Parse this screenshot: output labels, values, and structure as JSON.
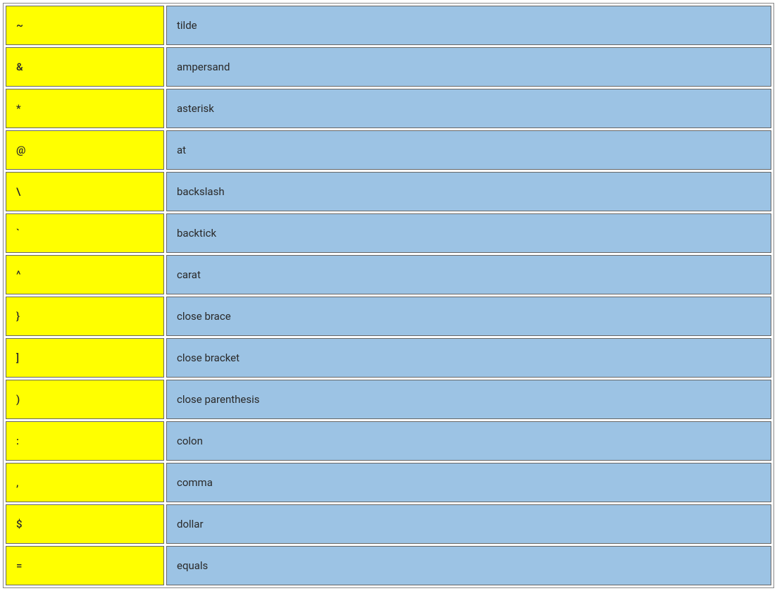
{
  "rows": [
    {
      "symbol": "~",
      "name": "tilde"
    },
    {
      "symbol": "&",
      "name": "ampersand"
    },
    {
      "symbol": "*",
      "name": "asterisk"
    },
    {
      "symbol": "@",
      "name": "at"
    },
    {
      "symbol": "\\",
      "name": "backslash"
    },
    {
      "symbol": "`",
      "name": "backtick"
    },
    {
      "symbol": "^",
      "name": "carat"
    },
    {
      "symbol": "}",
      "name": "close brace"
    },
    {
      "symbol": "]",
      "name": "close bracket"
    },
    {
      "symbol": ")",
      "name": "close parenthesis"
    },
    {
      "symbol": ":",
      "name": "colon"
    },
    {
      "symbol": ",",
      "name": "comma"
    },
    {
      "symbol": "$",
      "name": "dollar"
    },
    {
      "symbol": "=",
      "name": "equals"
    }
  ]
}
